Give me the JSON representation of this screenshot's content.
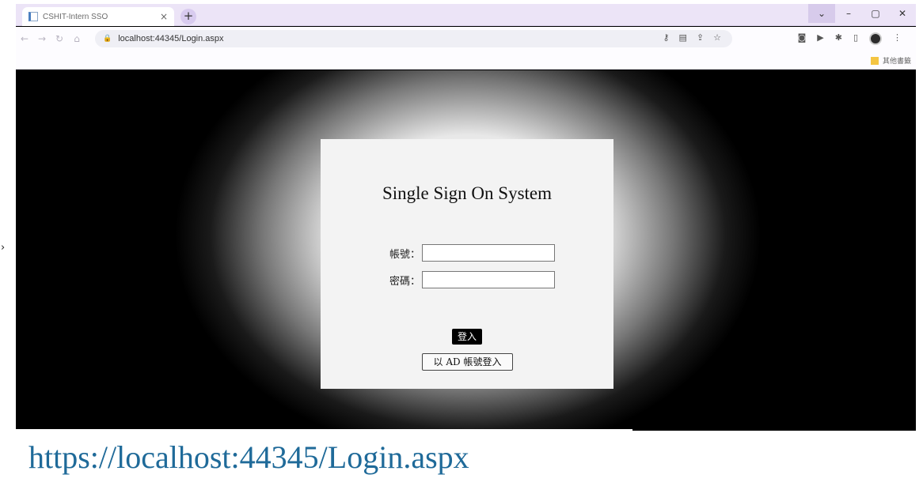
{
  "browser": {
    "tab_title": "CSHIT-Intern SSO",
    "tab_close": "×",
    "new_tab": "+",
    "window_controls": [
      "⌄",
      "–",
      "▢",
      "✕"
    ],
    "url": "localhost:44345/Login.aspx",
    "bookmark_folder": "其他書籤"
  },
  "login": {
    "title": "Single Sign On System",
    "account_label": "帳號：",
    "password_label": "密碼：",
    "login_button": "登入",
    "ad_login_button": "以 AD 帳號登入"
  },
  "caption": "https://localhost:44345/Login.aspx",
  "colors": {
    "caption_text": "#1f6a99",
    "tabbar_bg": "#ece4f7",
    "card_bg": "#f3f3f3"
  }
}
